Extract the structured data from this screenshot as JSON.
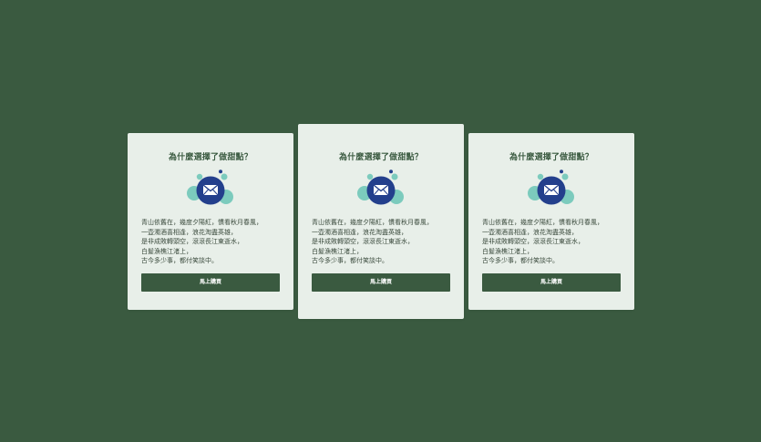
{
  "colors": {
    "background": "#3a5a40",
    "card": "#e8efe9",
    "accent": "#3a5a40",
    "icon_blue": "#233f8c",
    "icon_teal": "#7ccbbd"
  },
  "cards": [
    {
      "title": "為什麼選擇了做甜點？",
      "icon": "mail-icon",
      "lines": [
        "青山依舊在，幾度夕陽紅，慣看秋月春風，",
        "一壺濁酒喜相逢，浪花淘盡英雄，",
        "是非成敗轉頭空，滾滾長江東逝水，",
        "白髮漁樵江渚上，",
        "古今多少事，都付笑談中。"
      ],
      "button_label": "馬上購買"
    },
    {
      "title": "為什麼選擇了做甜點？",
      "icon": "mail-icon",
      "lines": [
        "青山依舊在，幾度夕陽紅，慣看秋月春風，",
        "一壺濁酒喜相逢，浪花淘盡英雄，",
        "是非成敗轉頭空，滾滾長江東逝水，",
        "白髮漁樵江渚上，",
        "古今多少事，都付笑談中。"
      ],
      "button_label": "馬上購買"
    },
    {
      "title": "為什麼選擇了做甜點？",
      "icon": "mail-icon",
      "lines": [
        "青山依舊在，幾度夕陽紅，慣看秋月春風，",
        "一壺濁酒喜相逢，浪花淘盡英雄，",
        "是非成敗轉頭空，滾滾長江東逝水，",
        "白髮漁樵江渚上，",
        "古今多少事，都付笑談中。"
      ],
      "button_label": "馬上購買"
    }
  ]
}
